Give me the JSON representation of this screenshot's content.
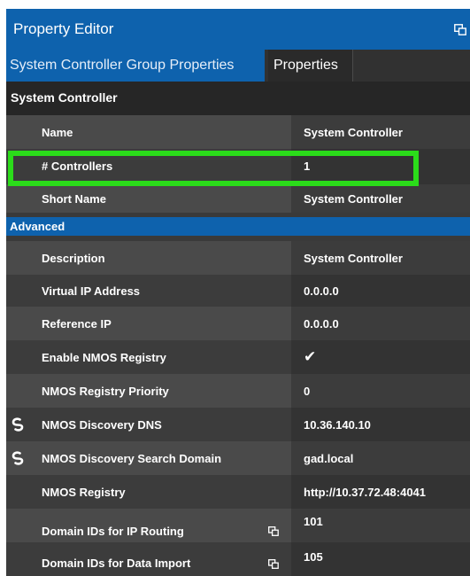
{
  "window": {
    "title": "Property Editor",
    "undock_icon": "undock-icon"
  },
  "tabs": [
    {
      "label": "System Controller Group Properties",
      "active": true
    },
    {
      "label": "Properties",
      "active": false
    }
  ],
  "sections": {
    "system_controller": "System Controller",
    "advanced": "Advanced"
  },
  "properties": [
    {
      "name": "Name",
      "value": "System Controller"
    },
    {
      "name": "# Controllers",
      "value": "1"
    },
    {
      "name": "Short Name",
      "value": "System Controller"
    },
    {
      "name": "Description",
      "value": "System Controller"
    },
    {
      "name": "Virtual IP Address",
      "value": "0.0.0.0"
    },
    {
      "name": "Reference IP",
      "value": "0.0.0.0"
    },
    {
      "name": "Enable NMOS Registry",
      "value": "✔",
      "checked": true
    },
    {
      "name": "NMOS Registry Priority",
      "value": "0"
    },
    {
      "name": "NMOS Discovery DNS",
      "value": "10.36.140.10",
      "icon": "link-icon"
    },
    {
      "name": "NMOS Discovery Search Domain",
      "value": "gad.local",
      "icon": "link-icon"
    },
    {
      "name": "NMOS Registry",
      "value": "http://10.37.72.48:4041"
    },
    {
      "name": "Domain IDs for IP Routing",
      "value": "101",
      "icon": "popout-icon"
    },
    {
      "name": "Domain IDs for Data Import",
      "value": "105",
      "icon": "popout-icon"
    }
  ],
  "colors": {
    "title_bar": "#0e62ad",
    "highlight": "#2bdc1a",
    "panel": "#3a3a3a"
  }
}
